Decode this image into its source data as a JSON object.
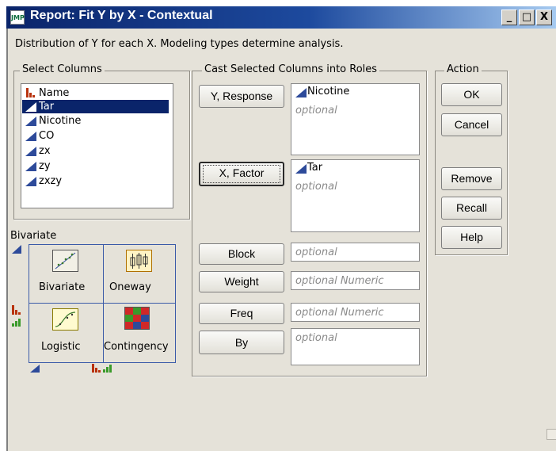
{
  "window": {
    "title": "Report: Fit Y by X - Contextual",
    "minimize": "_",
    "maximize": "□",
    "close": "X"
  },
  "description": "Distribution of Y for each X. Modeling types determine analysis.",
  "select_columns": {
    "title": "Select Columns",
    "items": [
      {
        "label": "Name",
        "type": "nominal-icon"
      },
      {
        "label": "Tar",
        "type": "continuous-icon",
        "selected": true
      },
      {
        "label": "Nicotine",
        "type": "continuous-icon"
      },
      {
        "label": "CO",
        "type": "continuous-icon"
      },
      {
        "label": "zx",
        "type": "continuous-icon"
      },
      {
        "label": "zy",
        "type": "continuous-icon"
      },
      {
        "label": "zxzy",
        "type": "continuous-icon"
      }
    ]
  },
  "palette": {
    "title": "Bivariate",
    "cells": [
      "Bivariate",
      "Oneway",
      "Logistic",
      "Contingency"
    ]
  },
  "cast_roles": {
    "title": "Cast Selected Columns into Roles",
    "roles": [
      {
        "button": "Y, Response",
        "value": "Nicotine",
        "placeholder": "optional"
      },
      {
        "button": "X, Factor",
        "value": "Tar",
        "placeholder": "optional"
      },
      {
        "button": "Block",
        "placeholder": "optional"
      },
      {
        "button": "Weight",
        "placeholder": "optional Numeric"
      },
      {
        "button": "Freq",
        "placeholder": "optional Numeric"
      },
      {
        "button": "By",
        "placeholder": "optional"
      }
    ]
  },
  "action": {
    "title": "Action",
    "ok": "OK",
    "cancel": "Cancel",
    "remove": "Remove",
    "recall": "Recall",
    "help": "Help"
  },
  "colors": {
    "continuous": "#2d4a9a",
    "nominal": "#b8320d",
    "ordinal": "#3a9a2a",
    "selection": "#0a246a"
  }
}
